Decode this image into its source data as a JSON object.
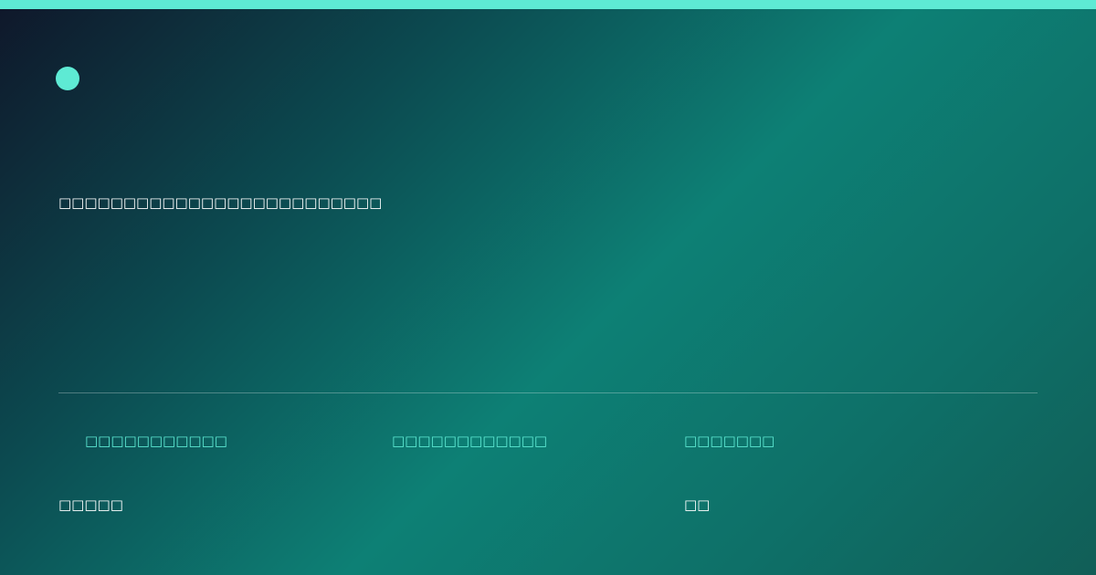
{
  "brand": {
    "accent_color": "#5eead4",
    "logo_icon": "circle-logo-icon"
  },
  "headline": {
    "text": "□□□□□□□□□□□□□□□□□□□□□□□□□"
  },
  "stats": [
    {
      "label": "□□□□□□□□□□□",
      "value": "□□□□□"
    },
    {
      "label": "□□□□□□□□□□□□",
      "value": ""
    },
    {
      "label": "□□□□□□□",
      "value": "□□"
    }
  ]
}
